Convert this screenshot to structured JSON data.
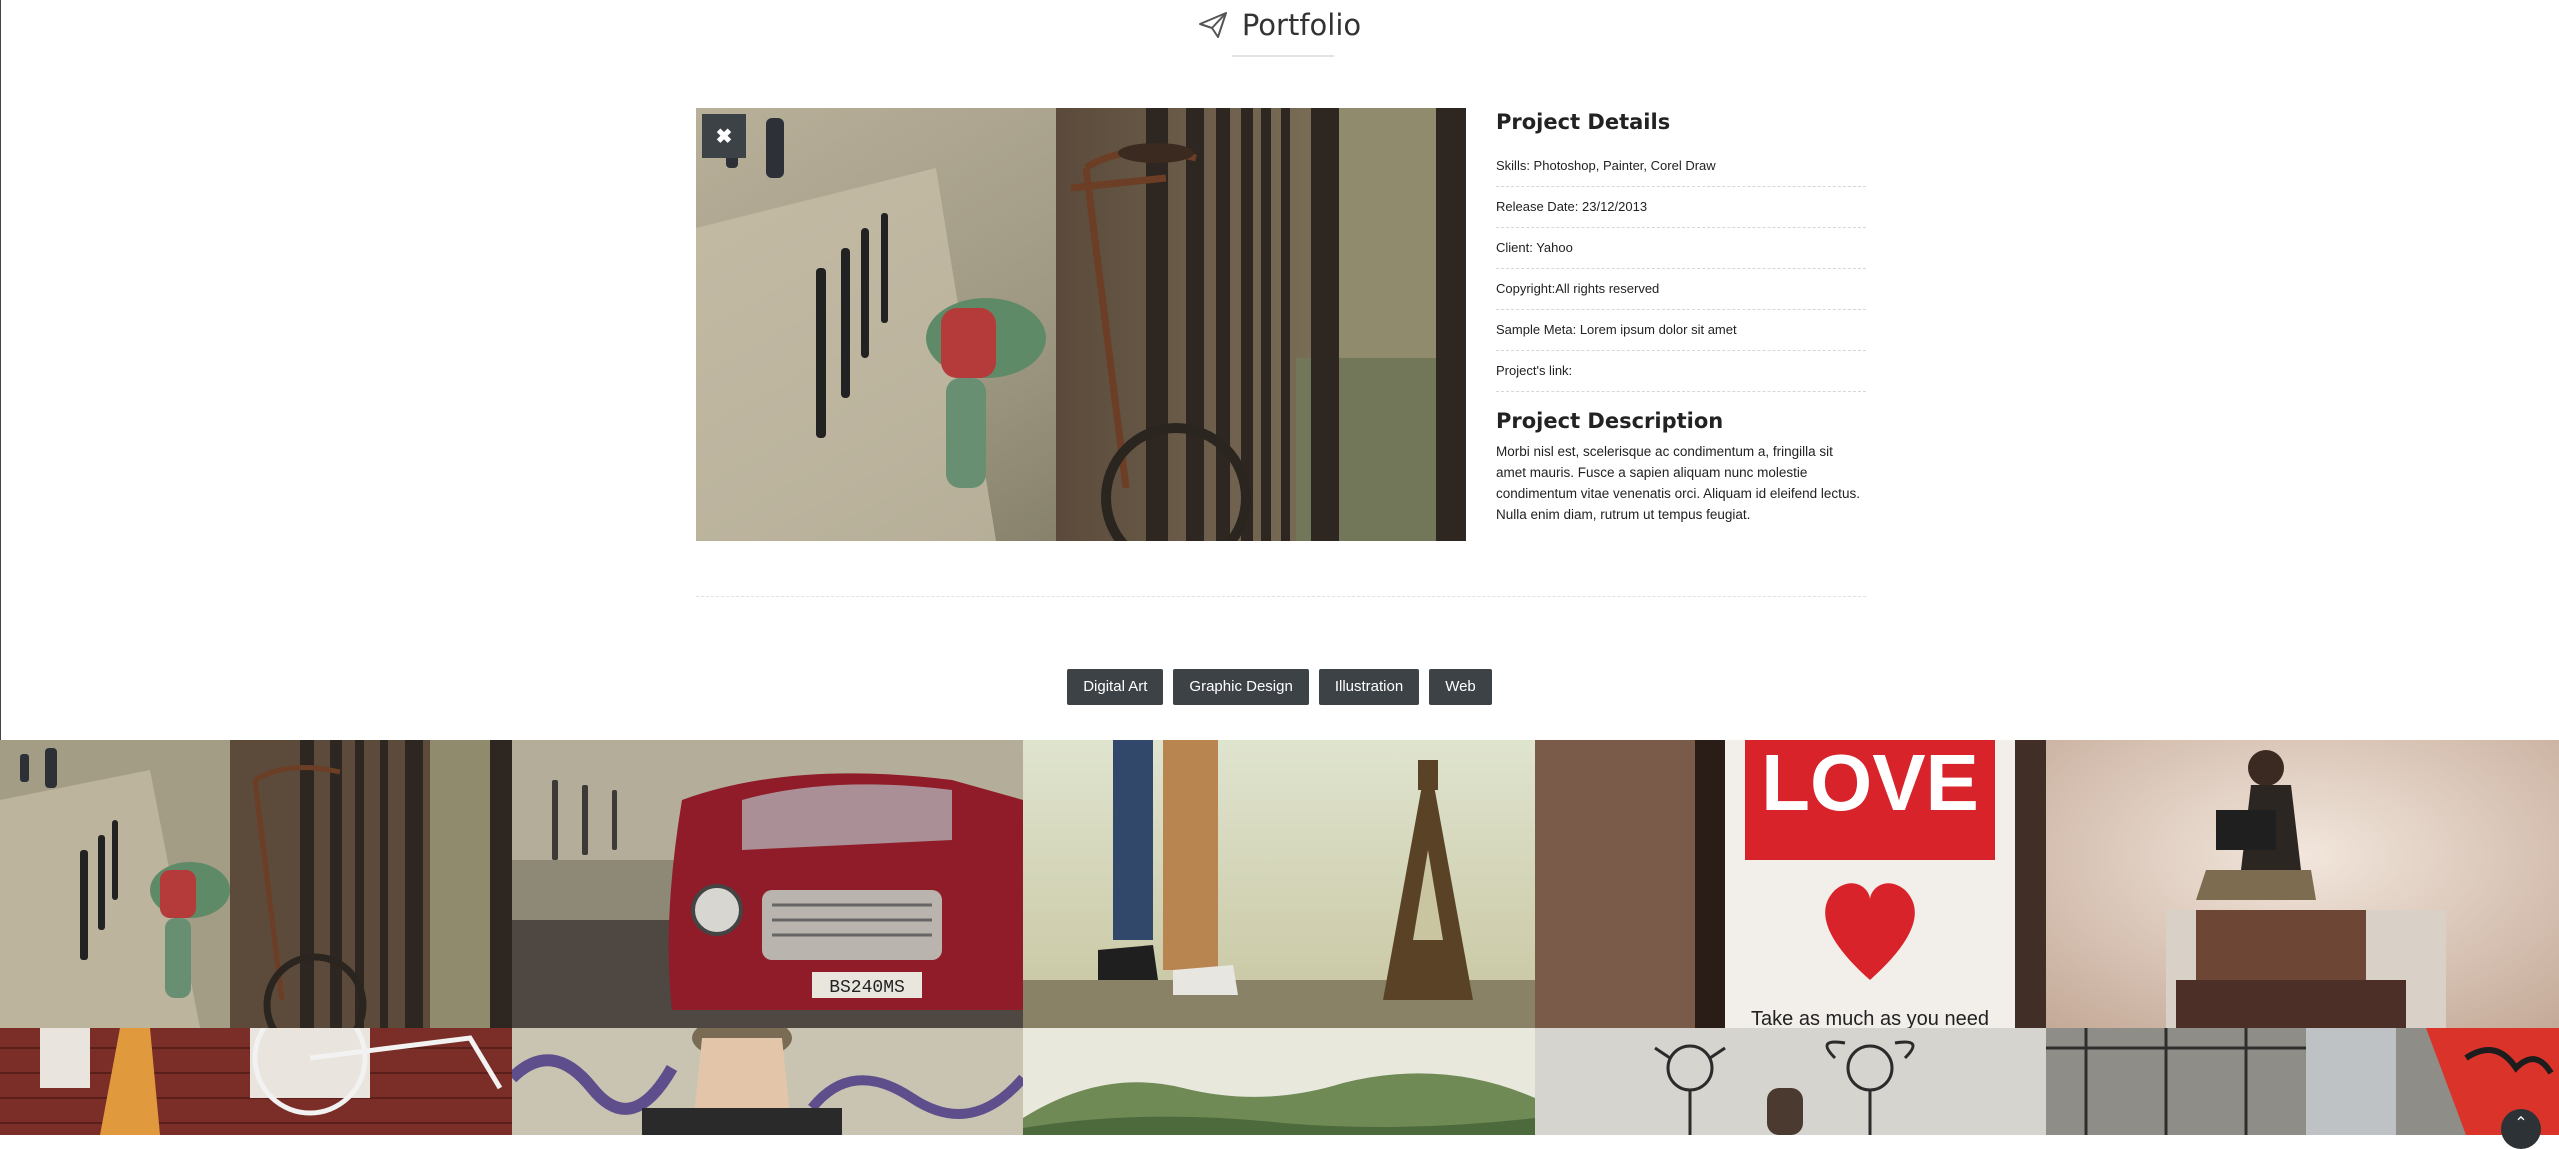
{
  "header": {
    "title": "Portfolio",
    "icon": "paper-plane-icon"
  },
  "hero": {
    "close_label": "✖",
    "close_icon": "close-icon"
  },
  "details": {
    "title": "Project Details",
    "rows": [
      {
        "text": "Skills: Photoshop, Painter, Corel Draw"
      },
      {
        "text": "Release Date: 23/12/2013"
      },
      {
        "text": "Client: Yahoo"
      },
      {
        "text": "Copyright:All rights reserved"
      },
      {
        "text": "Sample Meta: Lorem ipsum dolor sit amet"
      },
      {
        "text": "Project's link:"
      }
    ],
    "description_title": "Project Description",
    "description": "Morbi nisl est, scelerisque ac condimentum a, fringilla sit amet mauris. Fusce a sapien aliquam nunc molestie condimentum vitae venenatis orci. Aliquam id eleifend lectus. Nulla enim diam, rutrum ut tempus feugiat."
  },
  "filters": [
    {
      "label": "Digital Art"
    },
    {
      "label": "Graphic Design"
    },
    {
      "label": "Illustration"
    },
    {
      "label": "Web"
    }
  ],
  "grid_tiles": [
    {
      "name": "bicycle-photo",
      "love_text": ""
    },
    {
      "name": "red-car-photo",
      "plate": "BS240MS"
    },
    {
      "name": "eiffel-tower-photo"
    },
    {
      "name": "love-sign-photo",
      "love_text": "LOVE",
      "caption": "Take as much as you need"
    },
    {
      "name": "reading-girl-photo"
    },
    {
      "name": "bicycle-wall-photo"
    },
    {
      "name": "graffiti-man-photo"
    },
    {
      "name": "landscape-photo"
    },
    {
      "name": "street-art-photo"
    },
    {
      "name": "graffiti-sign-photo"
    }
  ],
  "scroll_top": "⌃",
  "colors": {
    "accent": "#3d4246",
    "love_red": "#d8232a"
  }
}
